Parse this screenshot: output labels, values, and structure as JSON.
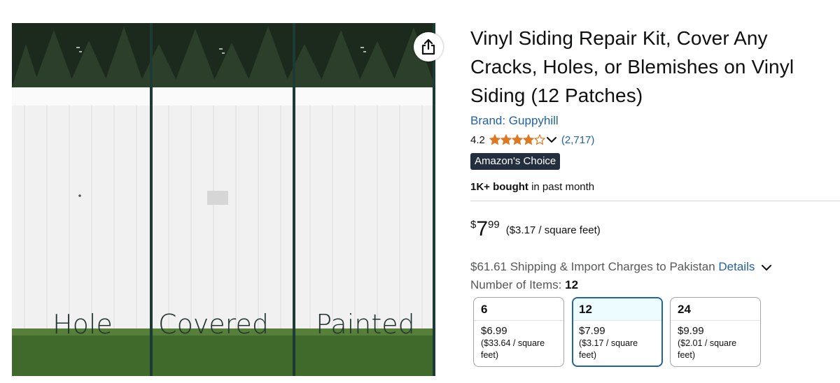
{
  "image": {
    "panel_labels": [
      "Hole",
      "Covered",
      "Painted"
    ]
  },
  "share": {
    "icon": "share-icon"
  },
  "product": {
    "title": "Vinyl Siding Repair Kit, Cover Any Cracks, Holes, or Blemishes on Vinyl Siding (12 Patches)",
    "brand": "Brand: Guppyhill",
    "rating": "4.2",
    "rating_stars_filled": 4.2,
    "rating_count": "(2,717)",
    "badge": "Amazon's Choice",
    "bought_bold": "1K+ bought",
    "bought_rest": " in past month"
  },
  "price": {
    "symbol": "$",
    "whole": "7",
    "fraction": "99",
    "unit": "($3.17 / square feet)"
  },
  "shipping": {
    "text": "$61.61 Shipping & Import Charges to Pakistan ",
    "details": "Details"
  },
  "items": {
    "label": "Number of Items: ",
    "selected": "12",
    "options": [
      {
        "count": "6",
        "price": "$6.99",
        "unit": "($33.64 / square feet)"
      },
      {
        "count": "12",
        "price": "$7.99",
        "unit": "($3.17 / square feet)"
      },
      {
        "count": "24",
        "price": "$9.99",
        "unit": "($2.01 / square feet)"
      }
    ]
  },
  "colors": {
    "link": "#2162a1",
    "star": "#de7921",
    "badge_bg": "#232f3e",
    "selected_border": "#2162a1"
  }
}
